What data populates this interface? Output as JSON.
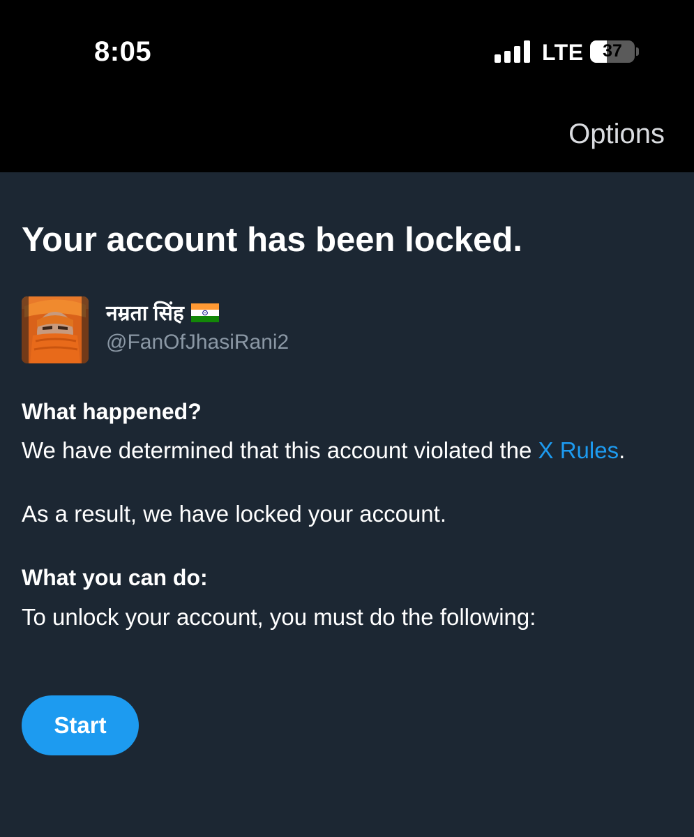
{
  "status_bar": {
    "time": "8:05",
    "network": "LTE",
    "battery_percent": "37",
    "battery_level": 0.37,
    "signal_bars": 4,
    "signal_icon": "cellular-signal-icon",
    "battery_icon": "battery-icon"
  },
  "header": {
    "options_label": "Options"
  },
  "main": {
    "title": "Your account has been locked.",
    "account": {
      "display_name": "नम्रता सिंह",
      "flag_icon": "india-flag-icon",
      "handle": "@FanOfJhasiRani2",
      "avatar_icon": "profile-avatar"
    },
    "what_happened_heading": "What happened?",
    "what_happened_text": "We have determined that this account violated the ",
    "rules_link": "X Rules",
    "what_happened_end": ".",
    "result_text": "As a result, we have locked your account.",
    "what_you_can_do_heading": "What you can do:",
    "unlock_text": "To unlock your account, you must do the following:",
    "start_button": "Start"
  },
  "colors": {
    "background": "#1c2733",
    "top_bar": "#000000",
    "accent": "#1d9bf0",
    "secondary_text": "#8b98a5"
  }
}
